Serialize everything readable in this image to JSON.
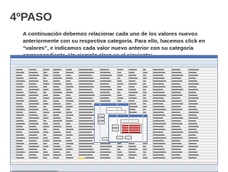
{
  "slide": {
    "title": "4ºPASO",
    "instructions": "A continuación debemos relacionar cada uno de los valores nuevos anteriormente con su respectiva categoría. Para ello, hacemos click en “valores”, e indicamos cada valor nuevo anterior con su categoría correspondiente. Un ejemplo claro es el siguiente:"
  },
  "screenshot": {
    "tabs": [
      "Vista de datos",
      "Vista de variables"
    ],
    "colors": {
      "window_title": "#4a73b8",
      "header_row": "#cfd8e6",
      "dialog_title": "#5078be",
      "selected_cell": "#f2d86b",
      "list_items": "#c02020"
    }
  }
}
